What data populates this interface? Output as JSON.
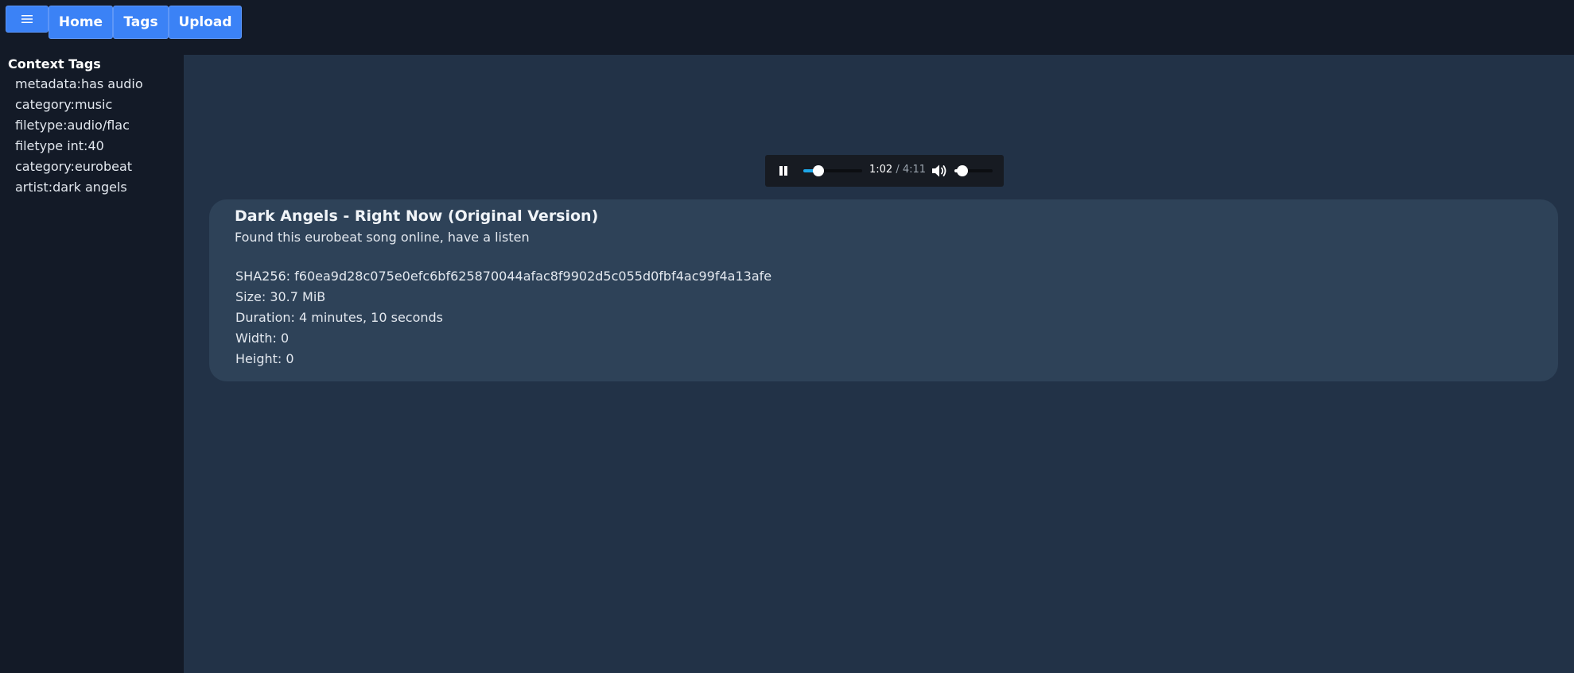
{
  "topbar": {
    "menu_icon": "hamburger-menu-icon",
    "nav": [
      {
        "label": "Home"
      },
      {
        "label": "Tags"
      },
      {
        "label": "Upload"
      }
    ]
  },
  "sidebar": {
    "title": "Context Tags",
    "tags": [
      "metadata:has audio",
      "category:music",
      "filetype:audio/flac",
      "filetype int:40",
      "category:eurobeat",
      "artist:dark angels"
    ]
  },
  "player": {
    "state": "playing",
    "play_pause_icon": "pause-icon",
    "current_time": "1:02",
    "separator": " / ",
    "total_time": "4:11",
    "progress_fraction": 0.25,
    "volume_icon": "speaker-volume-icon",
    "volume_fraction": 0.2,
    "accent_color": "#1ea7e8"
  },
  "card": {
    "title": "Dark Angels - Right Now (Original Version)",
    "description": "Found this eurobeat song online, have a listen",
    "meta": [
      "SHA256: f60ea9d28c075e0efc6bf625870044afac8f9902d5c055d0fbf4ac99f4a13afe",
      "Size: 30.7 MiB",
      "Duration: 4 minutes, 10 seconds",
      "Width: 0",
      "Height: 0"
    ]
  },
  "colors": {
    "button_blue": "#3b82f6",
    "page_bg": "#131a27",
    "main_bg": "#223247",
    "card_bg": "#2e4258"
  }
}
